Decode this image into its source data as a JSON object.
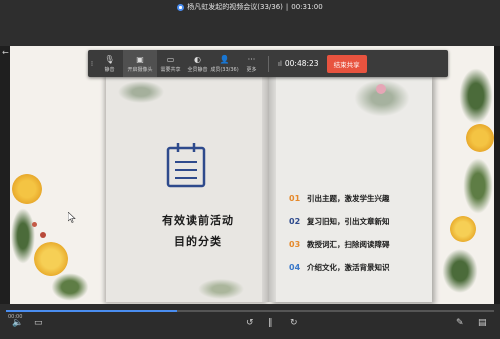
{
  "meeting": {
    "title": "杨凡虹发起的视频会议(33/36)",
    "duration": "00:31:00",
    "accent": "#4a8df0"
  },
  "toolbar": {
    "items": [
      {
        "label": "静音",
        "icon": "mic-icon"
      },
      {
        "label": "开启摄像头",
        "icon": "camera-icon"
      },
      {
        "label": "需要共享",
        "icon": "screen-share-icon"
      },
      {
        "label": "全员静音",
        "icon": "mute-all-icon"
      },
      {
        "label": "成员(33/36)",
        "icon": "members-icon"
      },
      {
        "label": "更多",
        "icon": "more-icon"
      }
    ],
    "timer": "00:48:23",
    "stop_label": "结束共享",
    "stop_color": "#e8533f"
  },
  "slide": {
    "heading_line1": "有效读前活动",
    "heading_line2": "目的分类",
    "items": [
      {
        "num": "01",
        "text": "引出主题，激发学生兴趣",
        "color": "#e5892b"
      },
      {
        "num": "02",
        "text": "复习旧知，引出文章新知",
        "color": "#2e4a8c"
      },
      {
        "num": "03",
        "text": "教授词汇，扫除阅读障碍",
        "color": "#e5892b"
      },
      {
        "num": "04",
        "text": "介绍文化，激活背景知识",
        "color": "#3a78c9"
      }
    ]
  },
  "playback": {
    "timecode": "00:00",
    "progress": 0.35
  }
}
